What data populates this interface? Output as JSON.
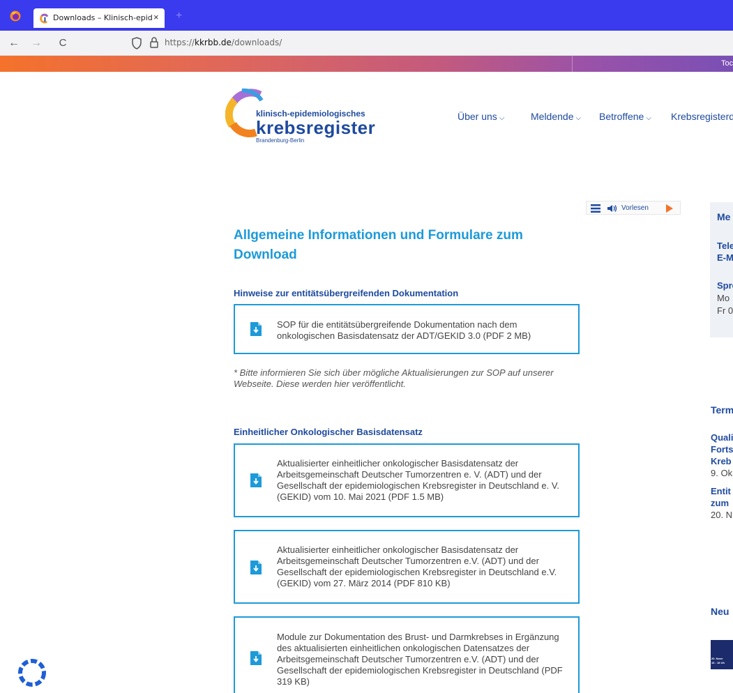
{
  "browser": {
    "tab_title": "Downloads – Klinisch-epidemic",
    "tab_close": "×",
    "new_tab": "+",
    "back": "←",
    "forward": "→",
    "reload": "C",
    "url_prefix": "https://",
    "url_host": "kkrbb.de",
    "url_path": "/downloads/"
  },
  "topbar": {
    "text": "Toc"
  },
  "logo": {
    "line1": "klinisch-epidemiologisches",
    "line2": "krebsregister",
    "line3": "Brandenburg-Berlin"
  },
  "nav": {
    "items": [
      {
        "label": "Über uns"
      },
      {
        "label": "Meldende"
      },
      {
        "label": "Betroffene"
      },
      {
        "label": "Krebsregisterd"
      }
    ],
    "chevron": "⌵"
  },
  "read_widget": {
    "label": "Vorlesen"
  },
  "main": {
    "title": "Allgemeine Informationen und Formulare zum Download",
    "section1": {
      "heading": "Hinweise zur entitätsübergreifenden Dokumentation",
      "downloads": [
        {
          "text": "SOP für die entitätsübergreifende Dokumentation nach dem onkologischen Basisdatensatz der ADT/GEKID 3.0 (PDF 2 MB)"
        }
      ],
      "note": "* Bitte informieren Sie sich über mögliche Aktualisierungen zur SOP auf unserer Webseite. Diese werden hier veröffentlicht."
    },
    "section2": {
      "heading": "Einheitlicher Onkologischer Basisdatensatz",
      "downloads": [
        {
          "text": "Aktualisierter einheitlicher onkologischer Basisdatensatz der Arbeitsgemeinschaft Deutscher Tumorzentren e. V. (ADT) und der Gesellschaft der epidemiologischen Krebsregister in Deutschland e. V. (GEKID) vom 10. Mai 2021 (PDF 1.5 MB)"
        },
        {
          "text": "Aktualisierter einheitlicher onkologischer Basisdatensatz der Arbeitsgemeinschaft Deutscher Tumorzentren e.V. (ADT) und der Gesellschaft der epidemiologischen Krebsregister in Deutschland e.V. (GEKID) vom 27. März 2014 (PDF 810 KB)"
        },
        {
          "text": "Module zur Dokumentation des Brust- und Darmkrebses in Ergänzung des aktualisierten einheitlichen onkologischen Datensatzes der Arbeitsgemeinschaft Deutscher Tumorzentren e.V. (ADT) und der Gesellschaft der epidemiologischen Krebsregister in Deutschland (PDF 319 KB)"
        }
      ]
    }
  },
  "sidebar": {
    "box_title": "Me",
    "contact1": "Tele",
    "contact2": "E-M",
    "hours_label": "Spre",
    "hours1": "Mo",
    "hours2": "Fr 0",
    "termine_title": "Term",
    "event1_l1": "Quali",
    "event1_l2": "Forts",
    "event1_l3": "Kreb",
    "event1_date": "9. Ok",
    "event2_l1": "Entit",
    "event2_l2": "zum",
    "event2_date": "20. N",
    "news_title": "Neu",
    "promo_l1": "20. Nove",
    "promo_l2": "16 - 18 Uh"
  },
  "colors": {
    "accent_blue": "#1d9ad8",
    "navy": "#1e4a9e",
    "orange": "#f4722b"
  }
}
